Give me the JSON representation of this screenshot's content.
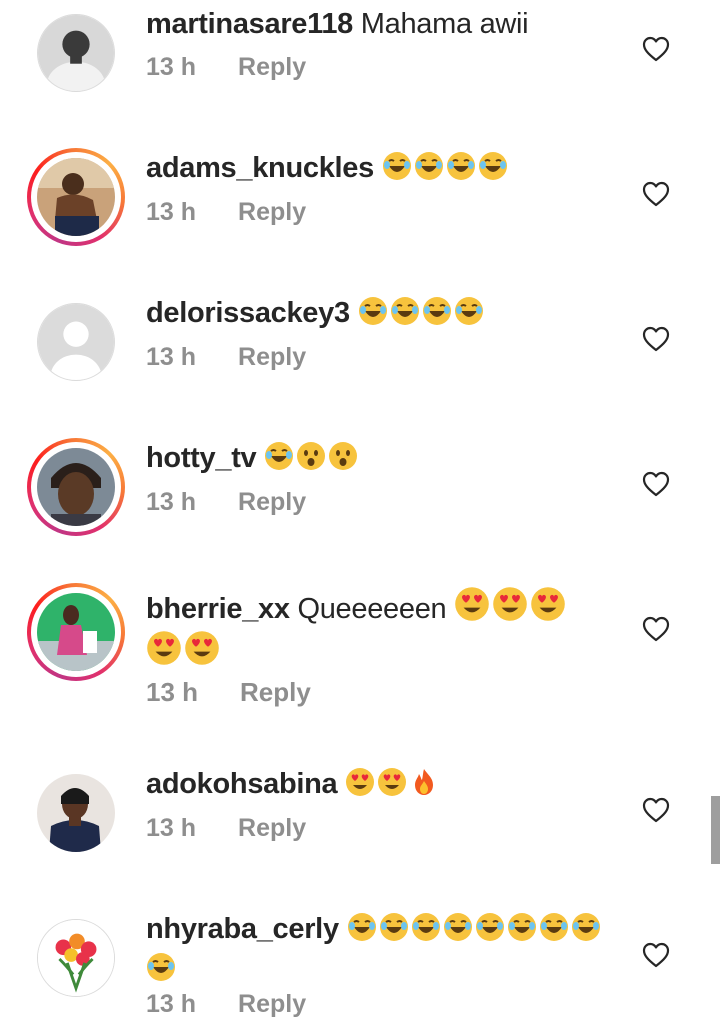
{
  "comments": [
    {
      "username": "martinasare118",
      "text": "Mahama awii",
      "emojis": [],
      "time": "13 h",
      "reply": "Reply",
      "avatar": "bw-photo",
      "story": false
    },
    {
      "username": "adams_knuckles",
      "text": "",
      "emojis": [
        "laugh",
        "laugh",
        "laugh",
        "laugh"
      ],
      "time": "13 h",
      "reply": "Reply",
      "avatar": "photo-man",
      "story": true
    },
    {
      "username": "delorissackey3",
      "text": "",
      "emojis": [
        "laugh",
        "laugh",
        "laugh",
        "laugh"
      ],
      "time": "13 h",
      "reply": "Reply",
      "avatar": "default",
      "story": false
    },
    {
      "username": "hotty_tv",
      "text": "",
      "emojis": [
        "laugh",
        "wow",
        "wow"
      ],
      "time": "13 h",
      "reply": "Reply",
      "avatar": "photo-woman",
      "story": true
    },
    {
      "username": "bherrie_xx",
      "text": "Queeeeeen",
      "emojis": [
        "heart-eyes",
        "heart-eyes",
        "heart-eyes",
        "heart-eyes",
        "heart-eyes"
      ],
      "time": "13 h",
      "reply": "Reply",
      "avatar": "photo-green",
      "story": true
    },
    {
      "username": "adokohsabina",
      "text": "",
      "emojis": [
        "heart-eyes",
        "heart-eyes",
        "fire"
      ],
      "time": "13 h",
      "reply": "Reply",
      "avatar": "photo-woman2",
      "story": false
    },
    {
      "username": "nhyraba_cerly",
      "text": "",
      "emojis": [
        "laugh",
        "laugh",
        "laugh",
        "laugh",
        "laugh",
        "laugh",
        "laugh",
        "laugh",
        "laugh"
      ],
      "time": "13 h",
      "reply": "Reply",
      "avatar": "flowers",
      "story": false
    }
  ],
  "icons": {
    "like": "heart-outline-icon"
  },
  "colors": {
    "username": "#262626",
    "meta": "#8e8e8e",
    "story_ring": "#e1306c"
  }
}
